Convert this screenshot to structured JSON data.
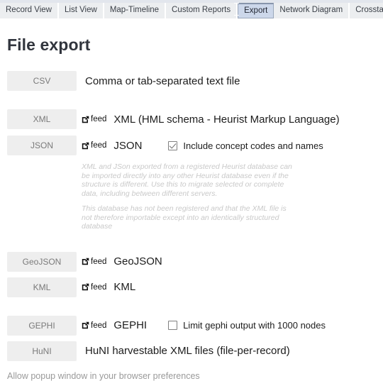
{
  "tabs": [
    {
      "label": "Record View",
      "active": false
    },
    {
      "label": "List View",
      "active": false
    },
    {
      "label": "Map-Timeline",
      "active": false
    },
    {
      "label": "Custom Reports",
      "active": false
    },
    {
      "label": "Export",
      "active": true
    },
    {
      "label": "Network Diagram",
      "active": false
    },
    {
      "label": "Crosstabs",
      "active": false
    }
  ],
  "page": {
    "title": "File export"
  },
  "feed": {
    "label": "feed",
    "icon": "external-link-icon"
  },
  "rows": {
    "csv": {
      "button": "CSV",
      "description": "Comma or tab-separated text file"
    },
    "xml": {
      "button": "XML",
      "feed": "feed",
      "description": "XML (HML schema - Heurist Markup Language)"
    },
    "json": {
      "button": "JSON",
      "feed": "feed",
      "description": "JSON",
      "option_label": "Include concept codes and names",
      "option_checked": true
    },
    "geojson": {
      "button": "GeoJSON",
      "feed": "feed",
      "description": "GeoJSON"
    },
    "kml": {
      "button": "KML",
      "feed": "feed",
      "description": "KML"
    },
    "gephi": {
      "button": "GEPHI",
      "feed": "feed",
      "description": "GEPHI",
      "option_label": "Limit gephi output with 1000 nodes",
      "option_checked": false
    },
    "huni": {
      "button": "HuNI",
      "description": "HuNI harvestable XML files (file-per-record)"
    }
  },
  "notes": {
    "paragraph1": "XML and JSon exported from a registered Heurist database can be imported directly into any other Heurist database even if the structure is different. Use this to migrate selected or complete data, including between different servers.",
    "paragraph2": "This database has not been registered and that the XML file is not therefore importable except into an identically structured database"
  },
  "footer": {
    "note": "Allow popup window in your browser preferences"
  },
  "colors": {
    "active_tab_bg": "#ccd7ea",
    "tab_bg": "#eceef0",
    "button_bg": "#eeeeee",
    "note_text": "#c9c9c9"
  }
}
